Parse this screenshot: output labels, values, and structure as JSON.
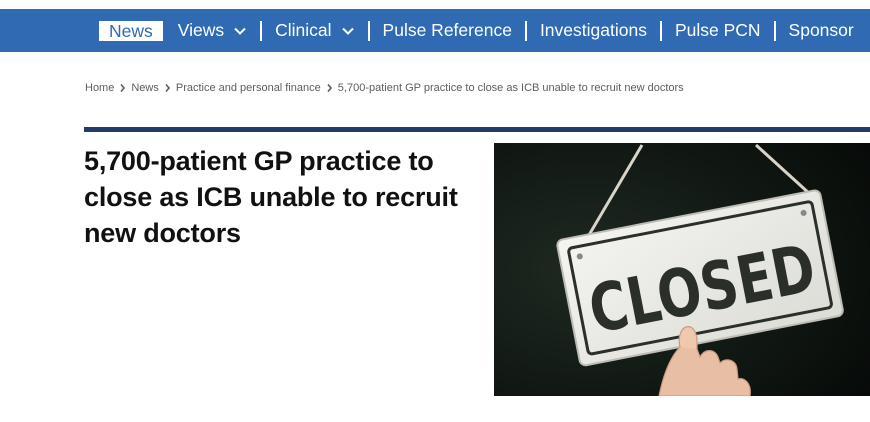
{
  "nav": {
    "items": [
      {
        "label": "News",
        "active": true,
        "dropdown": false
      },
      {
        "label": "Views",
        "active": false,
        "dropdown": true
      },
      {
        "label": "Clinical",
        "active": false,
        "dropdown": true
      },
      {
        "label": "Pulse Reference",
        "active": false,
        "dropdown": false
      },
      {
        "label": "Investigations",
        "active": false,
        "dropdown": false
      },
      {
        "label": "Pulse PCN",
        "active": false,
        "dropdown": false
      },
      {
        "label": "Sponsor",
        "active": false,
        "dropdown": false
      }
    ]
  },
  "breadcrumb": {
    "items": [
      "Home",
      "News",
      "Practice and personal finance",
      "5,700-patient GP practice to close as ICB unable to recruit new doctors"
    ]
  },
  "article": {
    "headline": "5,700-patient GP practice to close as ICB unable to recruit new doctors",
    "image": {
      "sign_text": "CLOSED"
    }
  },
  "colors": {
    "nav_bg": "#2f6ab3",
    "rule": "#223a6b",
    "headline": "#111111"
  }
}
